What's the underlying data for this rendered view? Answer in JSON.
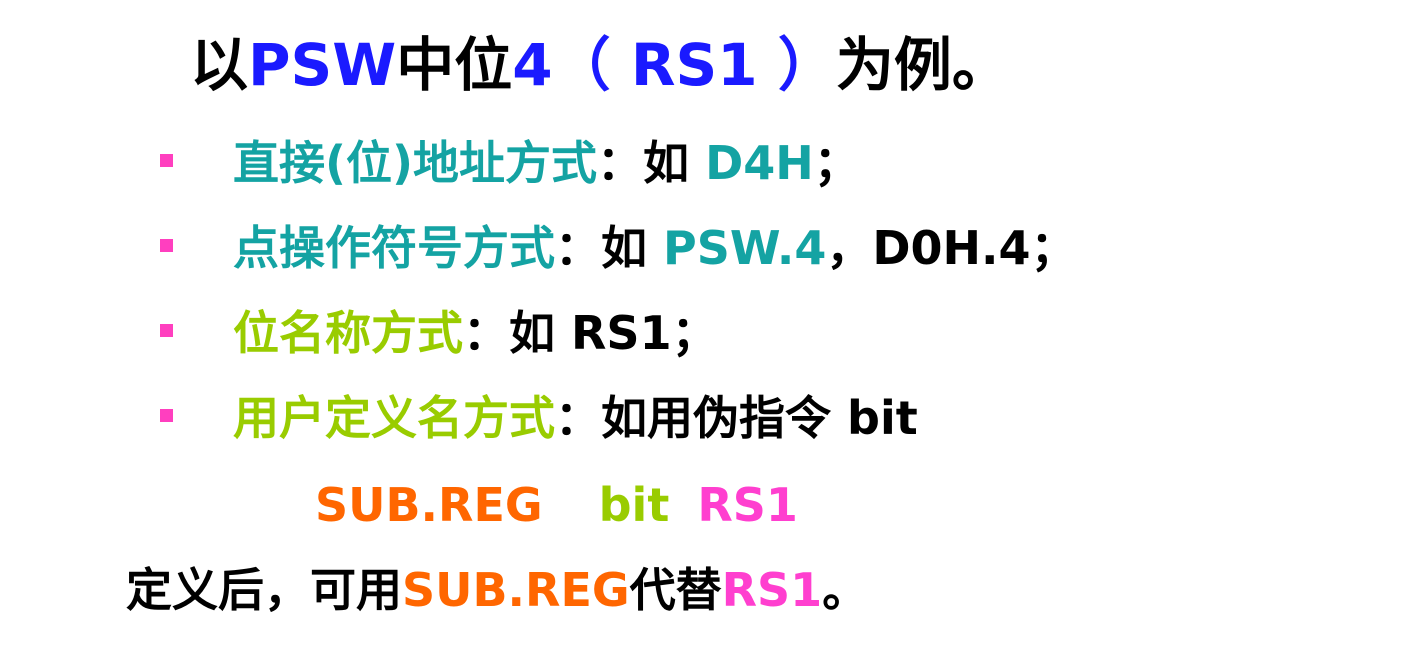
{
  "colors": {
    "blue": "#1a1aff",
    "teal": "#14a3a3",
    "lime": "#99cc00",
    "orange": "#ff6600",
    "magenta": "#ff3fcf",
    "black": "#000000",
    "bullet": "#ff3fbf"
  },
  "title": {
    "part1": "以",
    "psw": "PSW",
    "part2": "中位",
    "four": "4（ RS1 ）",
    "part3": "为例。"
  },
  "items": [
    {
      "label": "直接(位)地址方式",
      "sep": "：如 ",
      "example": "D4H",
      "end": "；"
    },
    {
      "label": "点操作符号方式",
      "sep": "：如 ",
      "example": "PSW.4",
      "mid": "，D0H.4",
      "end": "；"
    },
    {
      "label": "位名称方式",
      "sep": "：如 ",
      "example": "RS1",
      "end": "；"
    },
    {
      "label": "用户定义名方式",
      "sep": "：如用伪指令 bit"
    }
  ],
  "code": {
    "name": "SUB.REG",
    "keyword": "bit",
    "target": "RS1"
  },
  "footer": {
    "part1": "定义后，可用",
    "name": "SUB.REG",
    "part2": "代替",
    "target": "RS1",
    "end": "。"
  }
}
